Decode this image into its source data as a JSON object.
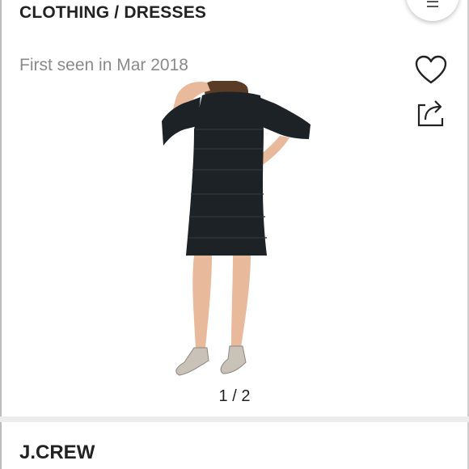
{
  "header": {
    "breadcrumb": "CLOTHING / DRESSES",
    "first_seen": "First seen in Mar 2018"
  },
  "actions": {
    "like_icon": "heart-icon",
    "share_icon": "share-icon",
    "fab_icon": "menu-icon"
  },
  "gallery": {
    "pager": "1 / 2",
    "dress_color": "#1c2226"
  },
  "listing": {
    "brand": "J.CREW"
  }
}
